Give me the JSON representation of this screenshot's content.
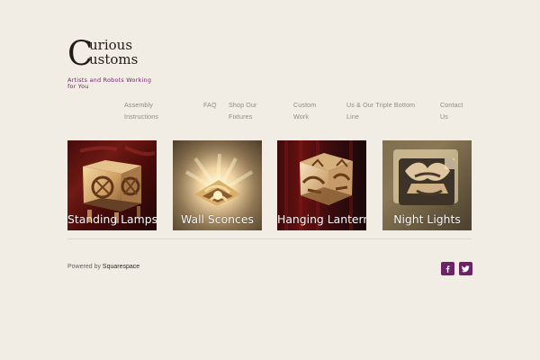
{
  "site": {
    "logo": {
      "initial": "C",
      "line1": "urious",
      "line2": "ustoms"
    },
    "tagline": "Artists and Robots Working for You"
  },
  "navigation": [
    {
      "label": "Assembly Instructions",
      "icon": ""
    },
    {
      "label": "FAQ",
      "icon": ""
    },
    {
      "label": "Shop Our Fixtures",
      "icon": ""
    },
    {
      "label": "Custom Work",
      "icon": ""
    },
    {
      "label": "Us & Our Triple Bottom Line",
      "icon": ""
    },
    {
      "label": "Contact Us",
      "icon": ""
    }
  ],
  "gallery": {
    "items": [
      {
        "label": "Standing Lamps",
        "image_subject": "standing-lamp-product-image"
      },
      {
        "label": "Wall Sconces",
        "image_subject": "wall-sconce-product-image"
      },
      {
        "label": "Hanging Lanterns",
        "image_subject": "hanging-lantern-product-image"
      },
      {
        "label": "Night Lights",
        "image_subject": "night-light-product-image"
      }
    ]
  },
  "footer": {
    "powered_by_prefix": "Powered by",
    "powered_by_link": "Squarespace",
    "social": [
      {
        "label": "Facebook",
        "icon": "facebook-icon"
      },
      {
        "label": "Twitter",
        "icon": "twitter-icon"
      }
    ]
  },
  "colors": {
    "background": "#f1ede4",
    "accent_purple": "#6b2368",
    "tagline_purple": "#6d2a67",
    "navigation_gray": "#8f8b85",
    "logo_dark": "#221b18"
  }
}
